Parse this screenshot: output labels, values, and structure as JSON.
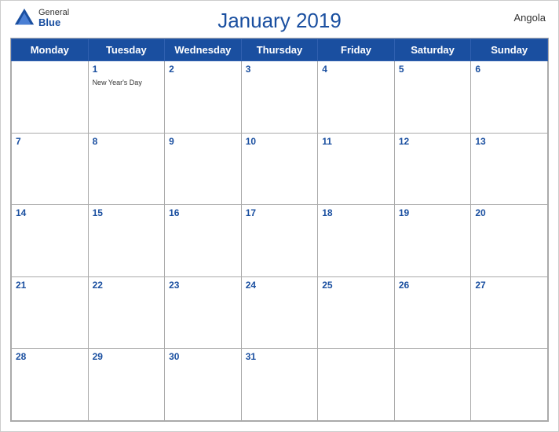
{
  "header": {
    "title": "January 2019",
    "country": "Angola",
    "logo_general": "General",
    "logo_blue": "Blue"
  },
  "weekdays": [
    "Monday",
    "Tuesday",
    "Wednesday",
    "Thursday",
    "Friday",
    "Saturday",
    "Sunday"
  ],
  "weeks": [
    [
      {
        "day": "",
        "empty": true
      },
      {
        "day": "1",
        "holiday": "New Year's Day"
      },
      {
        "day": "2"
      },
      {
        "day": "3"
      },
      {
        "day": "4"
      },
      {
        "day": "5"
      },
      {
        "day": "6"
      }
    ],
    [
      {
        "day": "7"
      },
      {
        "day": "8"
      },
      {
        "day": "9"
      },
      {
        "day": "10"
      },
      {
        "day": "11"
      },
      {
        "day": "12"
      },
      {
        "day": "13"
      }
    ],
    [
      {
        "day": "14"
      },
      {
        "day": "15"
      },
      {
        "day": "16"
      },
      {
        "day": "17"
      },
      {
        "day": "18"
      },
      {
        "day": "19"
      },
      {
        "day": "20"
      }
    ],
    [
      {
        "day": "21"
      },
      {
        "day": "22"
      },
      {
        "day": "23"
      },
      {
        "day": "24"
      },
      {
        "day": "25"
      },
      {
        "day": "26"
      },
      {
        "day": "27"
      }
    ],
    [
      {
        "day": "28"
      },
      {
        "day": "29"
      },
      {
        "day": "30"
      },
      {
        "day": "31"
      },
      {
        "day": ""
      },
      {
        "day": ""
      },
      {
        "day": ""
      }
    ]
  ],
  "colors": {
    "header_bg": "#1a4fa0",
    "header_text": "#ffffff",
    "title_color": "#1a4fa0"
  }
}
